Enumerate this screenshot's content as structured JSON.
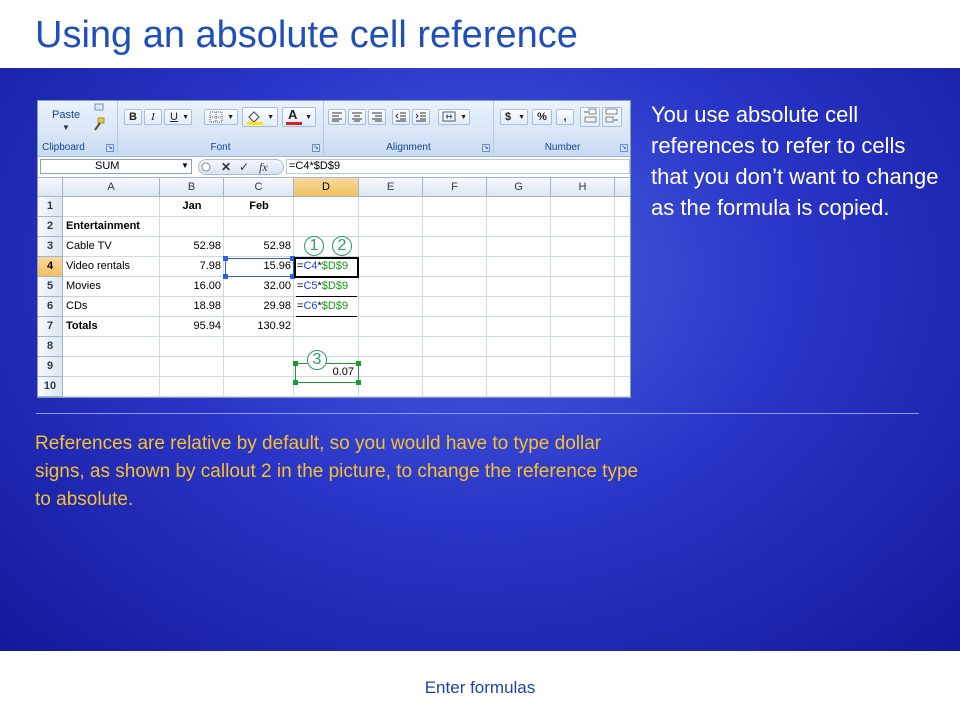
{
  "slide": {
    "title": "Using an absolute cell reference",
    "body_right": "You use absolute cell references to refer to cells that you don’t want to change as the formula is copied.",
    "body_bottom": "References are relative by default, so you would have to type dollar signs, as shown by callout 2 in the picture, to change the reference type to absolute.",
    "footer": "Enter formulas"
  },
  "colors": {
    "title": "#1f4fb8",
    "body_right": "#ffffff",
    "body_bottom": "#f7c12e",
    "callout": "#2e9a6b",
    "relative_ref": "#1f3fe0",
    "absolute_ref": "#119911"
  },
  "ribbon": {
    "groups": {
      "clipboard": "Clipboard",
      "font": "Font",
      "alignment": "Alignment",
      "number": "Number"
    },
    "paste_label": "Paste",
    "bold": "B",
    "italic": "I",
    "underline": "U",
    "font_color_letter": "A",
    "currency": "$",
    "percent": "%",
    "comma": ","
  },
  "formula_bar": {
    "name_box": "SUM",
    "fx": "fx",
    "formula": "=C4*$D$9"
  },
  "sheet": {
    "columns": [
      "A",
      "B",
      "C",
      "D",
      "E",
      "F",
      "G",
      "H"
    ],
    "rows": [
      "1",
      "2",
      "3",
      "4",
      "5",
      "6",
      "7",
      "8",
      "9",
      "10"
    ],
    "cells": {
      "B1": "Jan",
      "C1": "Feb",
      "A2": "Entertainment",
      "A3": "Cable TV",
      "B3": "52.98",
      "C3": "52.98",
      "A4": "Video rentals",
      "B4": "7.98",
      "C4": "15.96",
      "A5": "Movies",
      "B5": "16.00",
      "C5": "32.00",
      "A6": "CDs",
      "B6": "18.98",
      "C6": "29.98",
      "A7": "Totals",
      "B7": "95.94",
      "C7": "130.92",
      "D9": "0.07"
    },
    "formulas": {
      "D4": {
        "eq": "=",
        "rel": "C4",
        "op": "*",
        "abs": "$D$9"
      },
      "D5": {
        "eq": "=",
        "rel": "C5",
        "op": "*",
        "abs": "$D$9"
      },
      "D6": {
        "eq": "=",
        "rel": "C6",
        "op": "*",
        "abs": "$D$9"
      }
    },
    "callouts": [
      "1",
      "2",
      "3"
    ]
  }
}
